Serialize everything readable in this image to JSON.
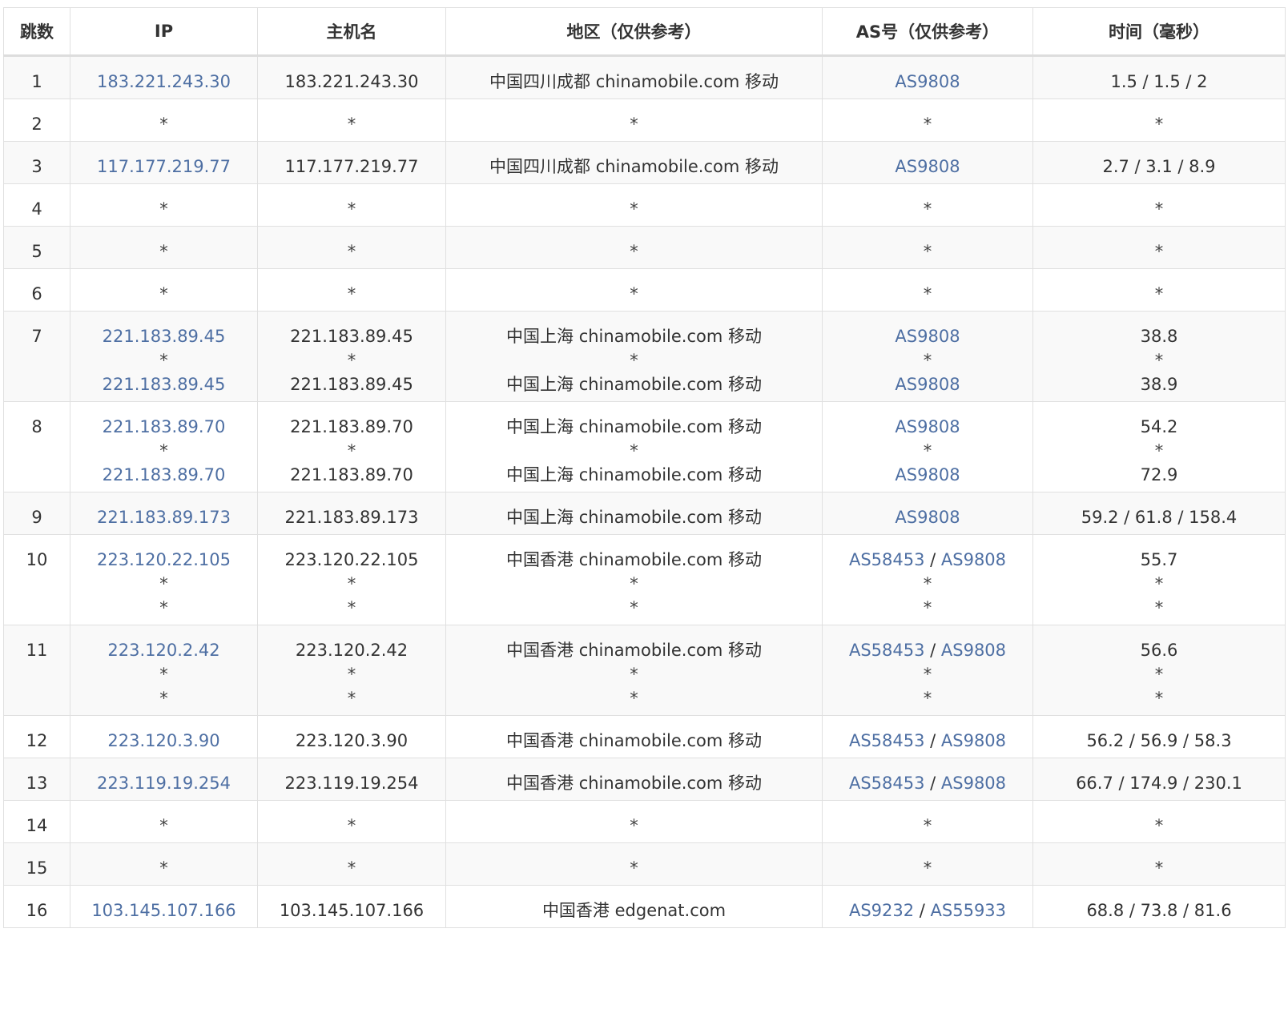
{
  "table": {
    "headers": [
      "跳数",
      "IP",
      "主机名",
      "地区（仅供参考）",
      "AS号（仅供参考）",
      "时间（毫秒）"
    ],
    "rows": [
      {
        "hop": "1",
        "ip": [
          "183.221.243.30"
        ],
        "host": [
          "183.221.243.30"
        ],
        "region": [
          "中国四川成都 chinamobile.com 移动"
        ],
        "as": [
          [
            "AS9808"
          ]
        ],
        "time": [
          "1.5 / 1.5 / 2"
        ]
      },
      {
        "hop": "2",
        "ip": [
          "*"
        ],
        "host": [
          "*"
        ],
        "region": [
          "*"
        ],
        "as": [
          [
            "*"
          ]
        ],
        "time": [
          "*"
        ]
      },
      {
        "hop": "3",
        "ip": [
          "117.177.219.77"
        ],
        "host": [
          "117.177.219.77"
        ],
        "region": [
          "中国四川成都 chinamobile.com 移动"
        ],
        "as": [
          [
            "AS9808"
          ]
        ],
        "time": [
          "2.7 / 3.1 / 8.9"
        ]
      },
      {
        "hop": "4",
        "ip": [
          "*"
        ],
        "host": [
          "*"
        ],
        "region": [
          "*"
        ],
        "as": [
          [
            "*"
          ]
        ],
        "time": [
          "*"
        ]
      },
      {
        "hop": "5",
        "ip": [
          "*"
        ],
        "host": [
          "*"
        ],
        "region": [
          "*"
        ],
        "as": [
          [
            "*"
          ]
        ],
        "time": [
          "*"
        ]
      },
      {
        "hop": "6",
        "ip": [
          "*"
        ],
        "host": [
          "*"
        ],
        "region": [
          "*"
        ],
        "as": [
          [
            "*"
          ]
        ],
        "time": [
          "*"
        ]
      },
      {
        "hop": "7",
        "ip": [
          "221.183.89.45",
          "*",
          "221.183.89.45"
        ],
        "host": [
          "221.183.89.45",
          "*",
          "221.183.89.45"
        ],
        "region": [
          "中国上海 chinamobile.com 移动",
          "*",
          "中国上海 chinamobile.com 移动"
        ],
        "as": [
          [
            "AS9808"
          ],
          [
            "*"
          ],
          [
            "AS9808"
          ]
        ],
        "time": [
          "38.8",
          "*",
          "38.9"
        ]
      },
      {
        "hop": "8",
        "ip": [
          "221.183.89.70",
          "*",
          "221.183.89.70"
        ],
        "host": [
          "221.183.89.70",
          "*",
          "221.183.89.70"
        ],
        "region": [
          "中国上海 chinamobile.com 移动",
          "*",
          "中国上海 chinamobile.com 移动"
        ],
        "as": [
          [
            "AS9808"
          ],
          [
            "*"
          ],
          [
            "AS9808"
          ]
        ],
        "time": [
          "54.2",
          "*",
          "72.9"
        ]
      },
      {
        "hop": "9",
        "ip": [
          "221.183.89.173"
        ],
        "host": [
          "221.183.89.173"
        ],
        "region": [
          "中国上海 chinamobile.com 移动"
        ],
        "as": [
          [
            "AS9808"
          ]
        ],
        "time": [
          "59.2 / 61.8 / 158.4"
        ]
      },
      {
        "hop": "10",
        "ip": [
          "223.120.22.105",
          "*",
          "*"
        ],
        "host": [
          "223.120.22.105",
          "*",
          "*"
        ],
        "region": [
          "中国香港 chinamobile.com 移动",
          "*",
          "*"
        ],
        "as": [
          [
            "AS58453",
            "AS9808"
          ],
          [
            "*"
          ],
          [
            "*"
          ]
        ],
        "time": [
          "55.7",
          "*",
          "*"
        ]
      },
      {
        "hop": "11",
        "ip": [
          "223.120.2.42",
          "*",
          "*"
        ],
        "host": [
          "223.120.2.42",
          "*",
          "*"
        ],
        "region": [
          "中国香港 chinamobile.com 移动",
          "*",
          "*"
        ],
        "as": [
          [
            "AS58453",
            "AS9808"
          ],
          [
            "*"
          ],
          [
            "*"
          ]
        ],
        "time": [
          "56.6",
          "*",
          "*"
        ]
      },
      {
        "hop": "12",
        "ip": [
          "223.120.3.90"
        ],
        "host": [
          "223.120.3.90"
        ],
        "region": [
          "中国香港 chinamobile.com 移动"
        ],
        "as": [
          [
            "AS58453",
            "AS9808"
          ]
        ],
        "time": [
          "56.2 / 56.9 / 58.3"
        ]
      },
      {
        "hop": "13",
        "ip": [
          "223.119.19.254"
        ],
        "host": [
          "223.119.19.254"
        ],
        "region": [
          "中国香港 chinamobile.com 移动"
        ],
        "as": [
          [
            "AS58453",
            "AS9808"
          ]
        ],
        "time": [
          "66.7 / 174.9 / 230.1"
        ]
      },
      {
        "hop": "14",
        "ip": [
          "*"
        ],
        "host": [
          "*"
        ],
        "region": [
          "*"
        ],
        "as": [
          [
            "*"
          ]
        ],
        "time": [
          "*"
        ]
      },
      {
        "hop": "15",
        "ip": [
          "*"
        ],
        "host": [
          "*"
        ],
        "region": [
          "*"
        ],
        "as": [
          [
            "*"
          ]
        ],
        "time": [
          "*"
        ]
      },
      {
        "hop": "16",
        "ip": [
          "103.145.107.166"
        ],
        "host": [
          "103.145.107.166"
        ],
        "region": [
          "中国香港 edgenat.com"
        ],
        "as": [
          [
            "AS9232",
            "AS55933"
          ]
        ],
        "time": [
          "68.8 / 73.8 / 81.6"
        ]
      }
    ]
  },
  "colors": {
    "link": "#4e6fa3",
    "text": "#333333",
    "stripe": "#f9f9f9",
    "border": "#e0e0e0"
  }
}
